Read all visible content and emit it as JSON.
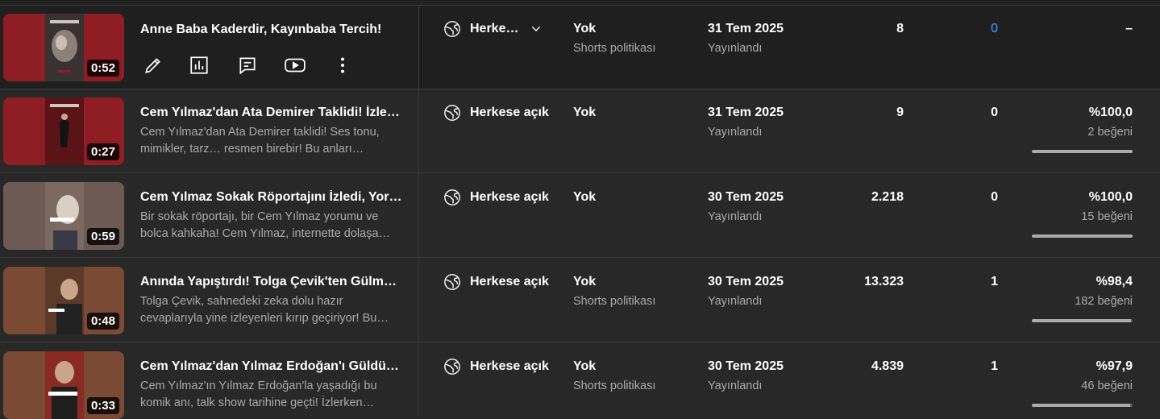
{
  "rows": [
    {
      "title": "Anne Baba Kaderdir, Kayınbaba Tercih!",
      "description": "",
      "duration": "0:52",
      "visibility": "Herke…",
      "restriction": "Yok",
      "restriction_sub": "Shorts politikası",
      "date": "31 Tem 2025",
      "date_sub": "Yayınlandı",
      "views": "8",
      "comments": "0",
      "likes": "–",
      "likes_sub": "",
      "like_ratio": null,
      "thumb_bg": "#8f1d24"
    },
    {
      "title": "Cem Yılmaz'dan Ata Demirer Taklidi! İzleye…",
      "description": "Cem Yılmaz'dan Ata Demirer taklidi! Ses tonu, mimikler, tarz… resmen birebir! Bu anları…",
      "duration": "0:27",
      "visibility": "Herkese açık",
      "restriction": "Yok",
      "restriction_sub": "",
      "date": "31 Tem 2025",
      "date_sub": "Yayınlandı",
      "views": "9",
      "comments": "0",
      "likes": "%100,0",
      "likes_sub": "2 beğeni",
      "like_ratio": 1.0,
      "thumb_bg": "#8f1d24"
    },
    {
      "title": "Cem Yılmaz Sokak Röportajını İzledi, Yoru…",
      "description": "Bir sokak röportajı, bir Cem Yılmaz yorumu ve bolca kahkaha! Cem Yılmaz, internette dolaşa…",
      "duration": "0:59",
      "visibility": "Herkese açık",
      "restriction": "Yok",
      "restriction_sub": "",
      "date": "30 Tem 2025",
      "date_sub": "Yayınlandı",
      "views": "2.218",
      "comments": "0",
      "likes": "%100,0",
      "likes_sub": "15 beğeni",
      "like_ratio": 1.0,
      "thumb_bg": "#6e5a54"
    },
    {
      "title": "Anında Yapıştırdı! Tolga Çevik'ten Gülme G…",
      "description": "Tolga Çevik, sahnedeki zeka dolu hazır cevaplarıyla yine izleyenleri kırıp geçiriyor! Bu…",
      "duration": "0:48",
      "visibility": "Herkese açık",
      "restriction": "Yok",
      "restriction_sub": "Shorts politikası",
      "date": "30 Tem 2025",
      "date_sub": "Yayınlandı",
      "views": "13.323",
      "comments": "1",
      "likes": "%98,4",
      "likes_sub": "182 beğeni",
      "like_ratio": 0.984,
      "thumb_bg": "#7a4a34"
    },
    {
      "title": "Cem Yılmaz'dan Yılmaz Erdoğan'ı Güldüren …",
      "description": "Cem Yılmaz'ın Yılmaz Erdoğan'la yaşadığı bu komik anı, talk show tarihine geçti! İzlerken…",
      "duration": "0:33",
      "visibility": "Herkese açık",
      "restriction": "Yok",
      "restriction_sub": "Shorts politikası",
      "date": "30 Tem 2025",
      "date_sub": "Yayınlandı",
      "views": "4.839",
      "comments": "1",
      "likes": "%97,9",
      "likes_sub": "46 beğeni",
      "like_ratio": 0.979,
      "thumb_bg": "#7a4a34"
    }
  ],
  "row_actions": [
    "pencil-icon",
    "analytics-icon",
    "comments-icon",
    "youtube-play-icon",
    "more-vert-icon"
  ],
  "colors": {
    "link": "#3ea6ff",
    "secondary_text": "#aaaaaa",
    "row_hover": "#1f1f1f",
    "background": "#282828"
  }
}
